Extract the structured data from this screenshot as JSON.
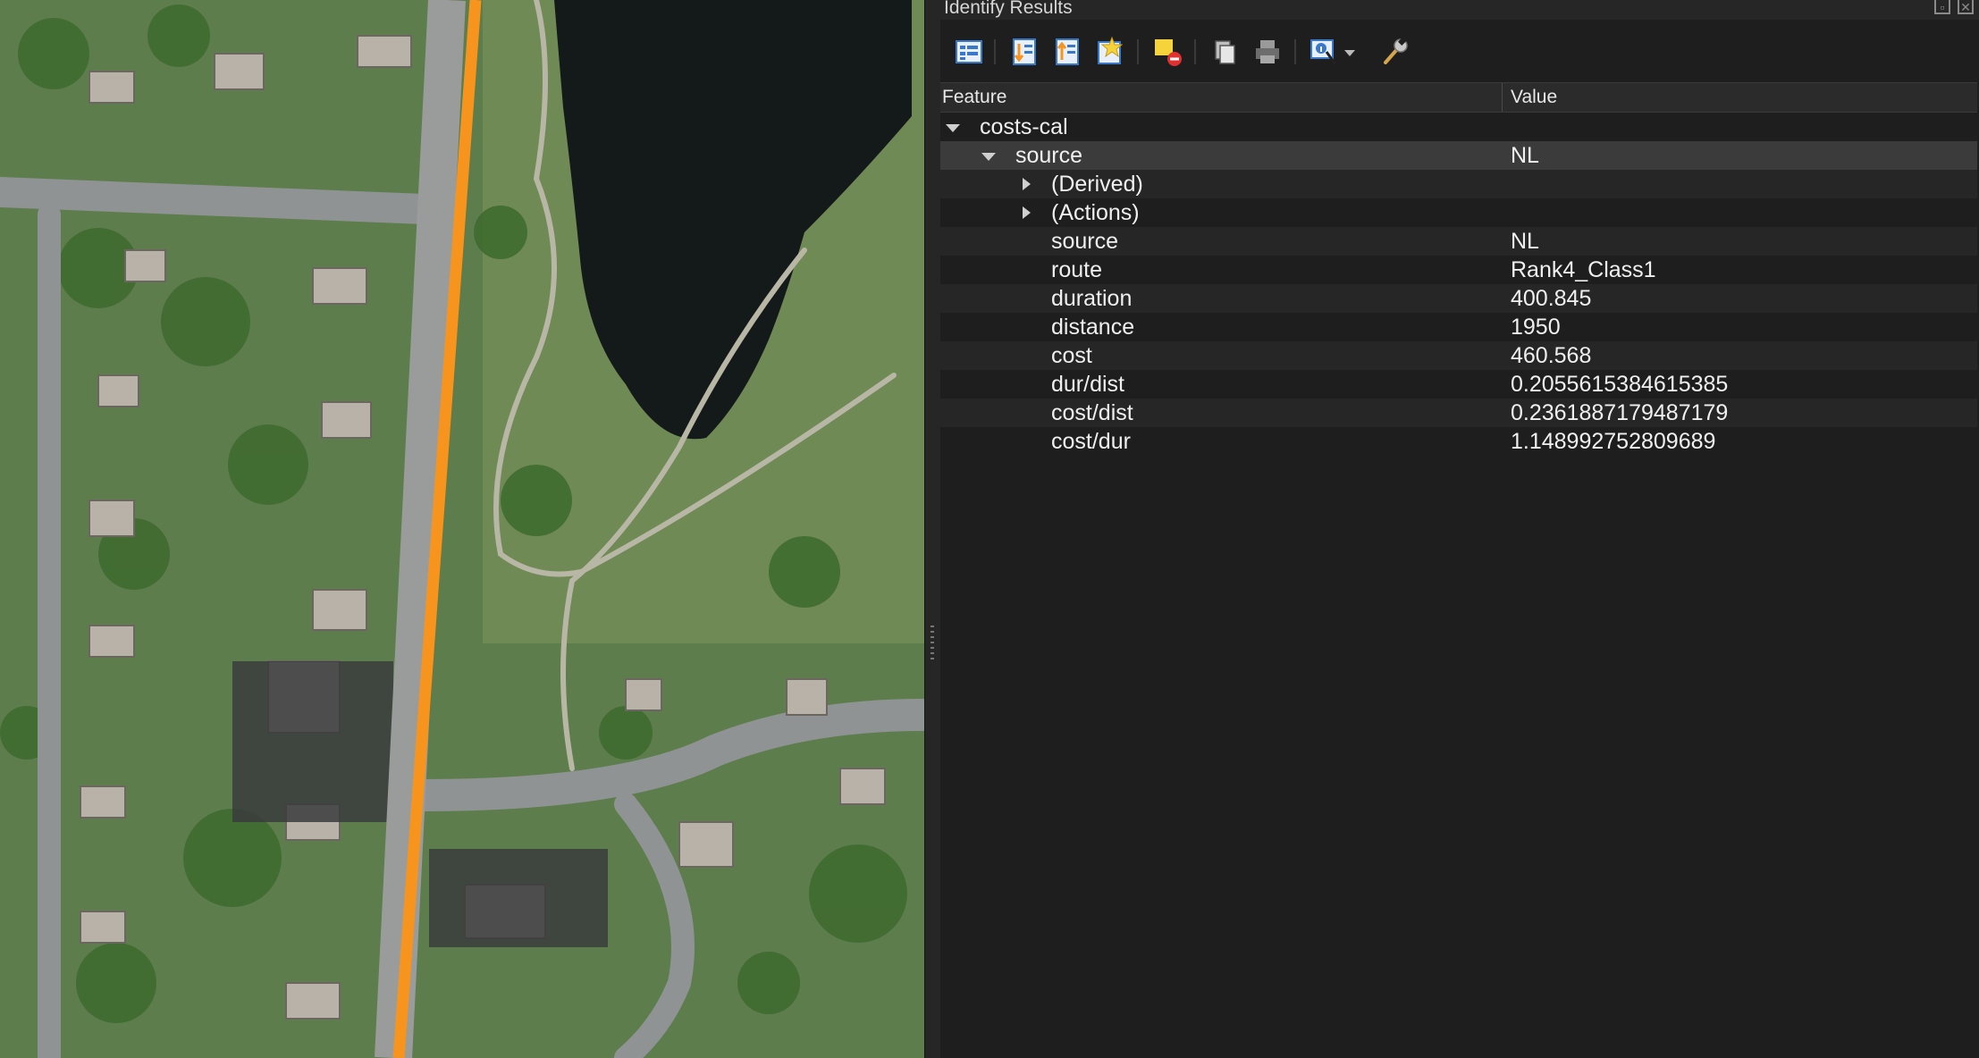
{
  "panel": {
    "title": "Identify Results",
    "toolbar": [
      {
        "name": "expand-tree-icon"
      },
      {
        "name": "expand-all-icon"
      },
      {
        "name": "collapse-all-icon"
      },
      {
        "name": "highlight-features-icon"
      },
      {
        "name": "clear-highlights-icon"
      },
      {
        "name": "copy-feature-icon"
      },
      {
        "name": "print-icon"
      },
      {
        "name": "identify-mode-icon"
      },
      {
        "name": "settings-wrench-icon"
      }
    ],
    "columns": {
      "feature": "Feature",
      "value": "Value"
    }
  },
  "tree": {
    "layer": "costs-cal",
    "feature": {
      "name": "source",
      "value": "NL"
    },
    "groups": [
      "(Derived)",
      "(Actions)"
    ],
    "attributes": [
      {
        "name": "source",
        "value": "NL"
      },
      {
        "name": "route",
        "value": "Rank4_Class1"
      },
      {
        "name": "duration",
        "value": "400.845"
      },
      {
        "name": "distance",
        "value": "1950"
      },
      {
        "name": "cost",
        "value": "460.568"
      },
      {
        "name": "dur/dist",
        "value": "0.2055615384615385"
      },
      {
        "name": "cost/dist",
        "value": "0.2361887179487179"
      },
      {
        "name": "cost/dur",
        "value": "1.148992752809689"
      }
    ]
  },
  "colors": {
    "route_highlight": "#f7941d",
    "panel_bg": "#1e1e1e",
    "selected_row": "#3b3b3b"
  }
}
